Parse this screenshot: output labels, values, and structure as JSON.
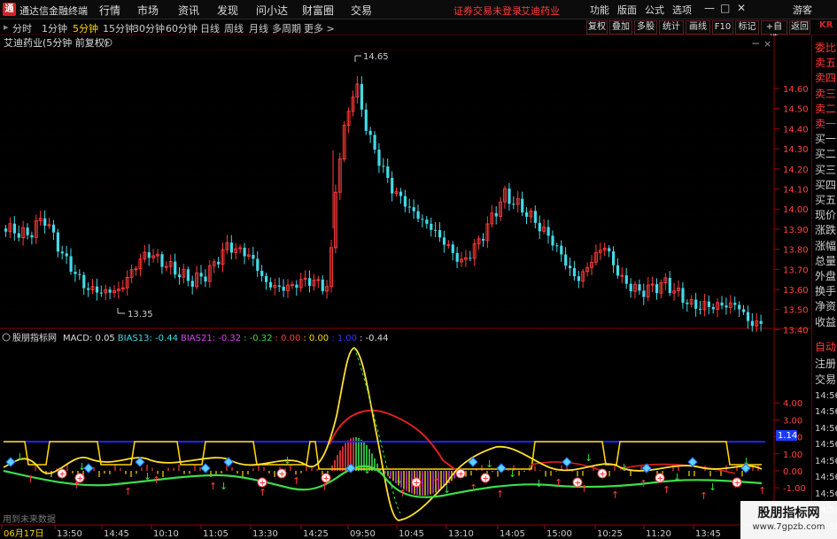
{
  "window": {
    "logo": "通",
    "title": "通达信金融终端",
    "menu": [
      "行情",
      "市场",
      "资讯",
      "发现",
      "问小达",
      "财富圈",
      "交易"
    ],
    "notice_login": "证券交易未登录",
    "notice_stock": "艾迪药业",
    "right_menu": [
      "功能",
      "版面",
      "公式",
      "选项"
    ],
    "window_controls": {
      "minimize": "—",
      "restore": "□",
      "close": "✕"
    },
    "guest": "游客"
  },
  "toolbar": {
    "periods": [
      "分时",
      "1分钟",
      "5分钟",
      "15分钟",
      "30分钟",
      "60分钟",
      "日线",
      "周线",
      "月线",
      "多周期",
      "更多 >"
    ],
    "active_index": 2,
    "right_buttons": [
      "复权",
      "叠加",
      "多股",
      "统计",
      "画线",
      "F10",
      "标记",
      "+自选",
      "返回"
    ]
  },
  "main_pane": {
    "title": "艾迪药业(5分钟 前复权)",
    "high_label": "14.65",
    "low_label": "13.35",
    "price_ticks": [
      "14.60",
      "14.50",
      "14.40",
      "14.30",
      "14.20",
      "14.10",
      "14.00",
      "13.90",
      "13.80",
      "13.70",
      "13.60",
      "13.50",
      "13.40"
    ]
  },
  "indicator_pane": {
    "name": "股朋指标网",
    "legend": [
      {
        "text": "MACD: 0.05",
        "color": "#dddddd"
      },
      {
        "text": "BIAS13: -0.44",
        "color": "#44d9e8"
      },
      {
        "text": "BIAS21: -0.32",
        "color": "#e040fb"
      },
      {
        "text": ": -0.32",
        "color": "#3ddc4a"
      },
      {
        "text": ": 0.00",
        "color": "#ff3b3b"
      },
      {
        "text": ": 0.00",
        "color": "#ffd400"
      },
      {
        "text": ": 1.00",
        "color": "#3333ff"
      },
      {
        "text": ": -0.44",
        "color": "#dddddd"
      }
    ],
    "y_ticks": [
      "4.00",
      "3.00",
      "2.00",
      "1.00",
      "0.00",
      "-1.00"
    ],
    "cursor_value": "1.14",
    "note": "用到未来数据"
  },
  "time_axis": [
    "06月17日",
    "13:50",
    "14:45",
    "10:10",
    "11:05",
    "13:30",
    "14:25",
    "09:50",
    "10:45",
    "13:10",
    "14:05",
    "15:00",
    "10:25",
    "11:20",
    "13:45"
  ],
  "right_panel": {
    "items": [
      "委比",
      "卖五",
      "卖四",
      "卖三",
      "卖二",
      "卖一",
      "买一",
      "买二",
      "买三",
      "买四",
      "买五",
      "现价",
      "涨跌",
      "涨幅",
      "总量",
      "外盘",
      "换手",
      "净资",
      "收益"
    ],
    "lower_items": [
      "自动",
      "注册",
      "交易",
      "14:56",
      "14:56",
      "14:56",
      "14:56",
      "14:56",
      "14:56",
      "14:56",
      "14:56",
      "14:56"
    ]
  },
  "watermark": {
    "name": "股朋指标网",
    "url": "www.7gpzb.com"
  },
  "colors": {
    "up": "#ff3b3b",
    "down": "#44d9e8",
    "accent": "#d2232a",
    "macd_line": "#ffd400",
    "blue_line": "#2222ff",
    "green_line": "#3ddc4a"
  },
  "chart_data": {
    "type": "candlestick",
    "high": 14.65,
    "low": 13.35,
    "ylim": [
      13.35,
      14.7
    ],
    "indicator_ylim": [
      -1.2,
      5.0
    ],
    "series_note": "5-minute candles across 3 sessions"
  }
}
